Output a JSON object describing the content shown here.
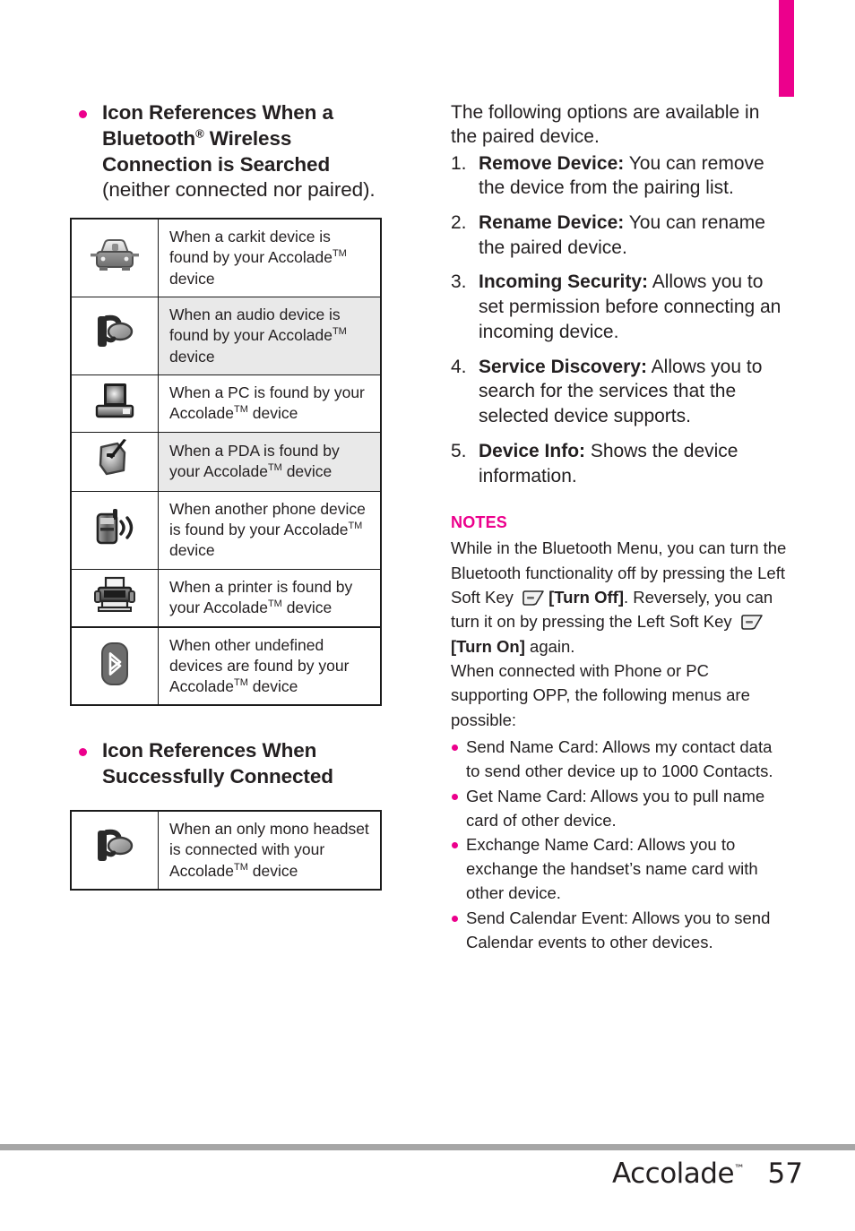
{
  "page": {
    "number": "57",
    "brand": "Accolade",
    "brand_tm": "™",
    "tab_color": "#ec008c"
  },
  "left_column": {
    "heading1": {
      "line1": "Icon References When a",
      "line2_pre": "Bluetooth",
      "line2_reg": "®",
      "line2_post": " Wireless",
      "line3": "Connection is Searched",
      "line4": "(neither connected nor paired)."
    },
    "table1_rows": [
      {
        "icon": "carkit-icon",
        "text_pre": "When a carkit device is found by your Accolade",
        "tm": "TM",
        "text_post": " device",
        "shaded": false
      },
      {
        "icon": "headset-icon",
        "text_pre": "When an audio device is found by your Accolade",
        "tm": "TM",
        "text_post": " device",
        "shaded": true
      },
      {
        "icon": "pc-icon",
        "text_pre": "When a PC is found by your Accolade",
        "tm": "TM",
        "text_post": " device",
        "shaded": false
      },
      {
        "icon": "pda-icon",
        "text_pre": "When a PDA is found by your Accolade",
        "tm": "TM",
        "text_post": " device",
        "shaded": true
      },
      {
        "icon": "phone-icon",
        "text_pre": "When another phone device is found by your Accolade",
        "tm": "TM",
        "text_post": " device",
        "shaded": false
      },
      {
        "icon": "printer-icon",
        "text_pre": "When a printer is found by your Accolade",
        "tm": "TM",
        "text_post": " device",
        "shaded": false
      },
      {
        "icon": "bluetooth-icon",
        "text_pre": "When other undefined devices are found by your Accolade",
        "tm": "TM",
        "text_post": " device",
        "shaded": false
      }
    ],
    "heading2": {
      "line1": "Icon References When",
      "line2": "Successfully Connected"
    },
    "table2_rows": [
      {
        "icon": "headset-icon",
        "text_pre": "When an only mono headset is connected with your Accolade",
        "tm": "TM",
        "text_post": " device",
        "shaded": false
      }
    ]
  },
  "right_column": {
    "intro": "The following options are available in the paired device.",
    "options": [
      {
        "num": "1.",
        "term": "Remove Device:",
        "desc": " You can remove the device from the pairing list."
      },
      {
        "num": "2.",
        "term": "Rename Device:",
        "desc": " You can rename the paired device."
      },
      {
        "num": "3.",
        "term": "Incoming Security:",
        "desc": " Allows you to set permission before connecting an incoming device."
      },
      {
        "num": "4.",
        "term": "Service Discovery:",
        "desc": " Allows you to search for the services that the selected device supports."
      },
      {
        "num": "5.",
        "term": "Device Info:",
        "desc": " Shows the device information."
      }
    ],
    "notes": {
      "title": "NOTES",
      "p1_a": "While in the Bluetooth Menu, you can turn the Bluetooth functionality off by pressing the Left Soft Key",
      "p1_b": "[Turn Off]",
      "p1_c": ". Reversely, you can turn it on by pressing the Left Soft Key",
      "p1_d": "[Turn On]",
      "p1_e": " again.",
      "p2": "When connected with Phone or PC supporting OPP, the following menus are possible:",
      "opp_items": [
        "Send Name Card: Allows my contact data to send other device up to 1000 Contacts.",
        "Get Name Card: Allows you to pull name card of other device.",
        "Exchange Name Card: Allows you to exchange the handset’s name card with other device.",
        "Send Calendar Event: Allows you to send Calendar events to other devices."
      ]
    }
  }
}
